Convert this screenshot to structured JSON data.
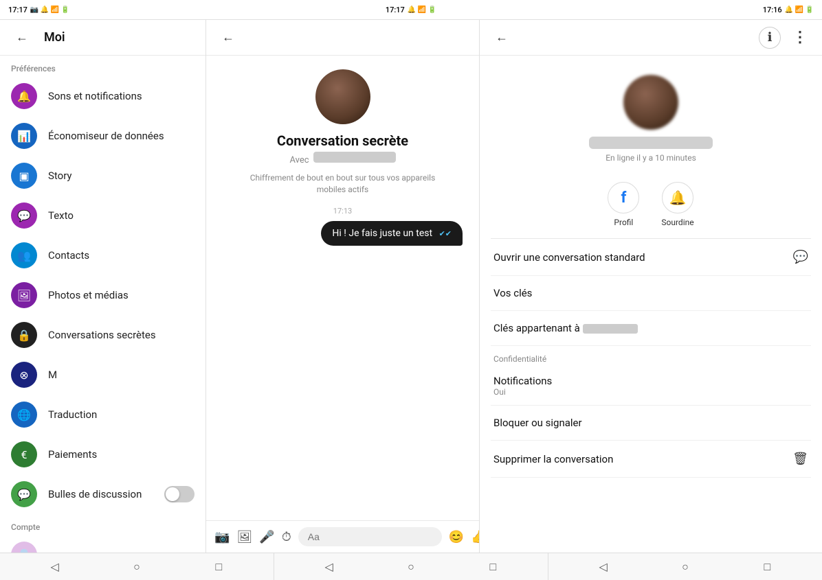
{
  "statusBar": {
    "left": {
      "time": "17:17"
    },
    "center": {
      "time": "17:17"
    },
    "right": {
      "time": "17:16"
    }
  },
  "panel1": {
    "header": {
      "backLabel": "←",
      "title": "Moi"
    },
    "sections": [
      {
        "label": "Préférences",
        "items": [
          {
            "id": "notifications",
            "label": "Sons et notifications",
            "color": "#9c27b0",
            "icon": "🔔",
            "hasToggle": false
          },
          {
            "id": "data",
            "label": "Économiseur de données",
            "color": "#1565c0",
            "icon": "📊",
            "hasToggle": false
          },
          {
            "id": "story",
            "label": "Story",
            "color": "#1976d2",
            "icon": "▣",
            "hasToggle": false
          },
          {
            "id": "texto",
            "label": "Texto",
            "color": "#9c27b0",
            "icon": "💬",
            "hasToggle": false
          },
          {
            "id": "contacts",
            "label": "Contacts",
            "color": "#0288d1",
            "icon": "👥",
            "hasToggle": false
          },
          {
            "id": "photos",
            "label": "Photos et médias",
            "color": "#7b1fa2",
            "icon": "🖼",
            "hasToggle": false
          },
          {
            "id": "secret",
            "label": "Conversations secrètes",
            "color": "#212121",
            "icon": "🔒",
            "hasToggle": false
          },
          {
            "id": "m",
            "label": "M",
            "color": "#1a237e",
            "icon": "⊗",
            "hasToggle": false
          },
          {
            "id": "traduction",
            "label": "Traduction",
            "color": "#1565c0",
            "icon": "🌐",
            "hasToggle": false
          },
          {
            "id": "paiements",
            "label": "Paiements",
            "color": "#2e7d32",
            "icon": "€",
            "hasToggle": false
          },
          {
            "id": "bulles",
            "label": "Bulles de discussion",
            "color": "#43a047",
            "icon": "💬",
            "hasToggle": true
          }
        ]
      },
      {
        "label": "Compte",
        "items": []
      }
    ]
  },
  "panel2": {
    "header": {
      "backLabel": "←"
    },
    "conversation": {
      "title": "Conversation secrète",
      "subtitlePrefix": "Avec",
      "description": "Chiffrement de bout en bout sur tous vos appareils mobiles actifs",
      "timestamp": "17:13",
      "message": "Hi ! Je fais juste un test",
      "checkmark": "✔✔"
    },
    "inputBar": {
      "placeholder": "Aa",
      "icons": [
        "📷",
        "🖼",
        "🎤",
        "⏱",
        "😊",
        "👍"
      ]
    }
  },
  "panel3": {
    "header": {
      "backLabel": "←",
      "moreIcon": "⋮"
    },
    "profile": {
      "statusText": "En ligne il y a 10 minutes"
    },
    "actions": [
      {
        "id": "profil",
        "icon": "f",
        "label": "Profil"
      },
      {
        "id": "sourdine",
        "icon": "🔔",
        "label": "Sourdine"
      }
    ],
    "menuItems": [
      {
        "id": "open-conv",
        "label": "Ouvrir une conversation standard",
        "icon": "💬"
      },
      {
        "id": "vos-cles",
        "label": "Vos clés",
        "icon": ""
      },
      {
        "id": "cles-app",
        "label": "Clés appartenant à",
        "hasBlur": true,
        "icon": ""
      }
    ],
    "confidentialite": {
      "sectionLabel": "Confidentialité",
      "items": [
        {
          "id": "notifications",
          "label": "Notifications",
          "sublabel": "Oui",
          "icon": ""
        },
        {
          "id": "bloquer",
          "label": "Bloquer ou signaler",
          "icon": ""
        },
        {
          "id": "supprimer",
          "label": "Supprimer la conversation",
          "icon": "🗑"
        }
      ]
    }
  },
  "bottomNav": {
    "sections": [
      {
        "buttons": [
          "◁",
          "○",
          "□"
        ]
      },
      {
        "buttons": [
          "◁",
          "○",
          "□"
        ]
      },
      {
        "buttons": [
          "◁",
          "○",
          "□"
        ]
      }
    ]
  }
}
